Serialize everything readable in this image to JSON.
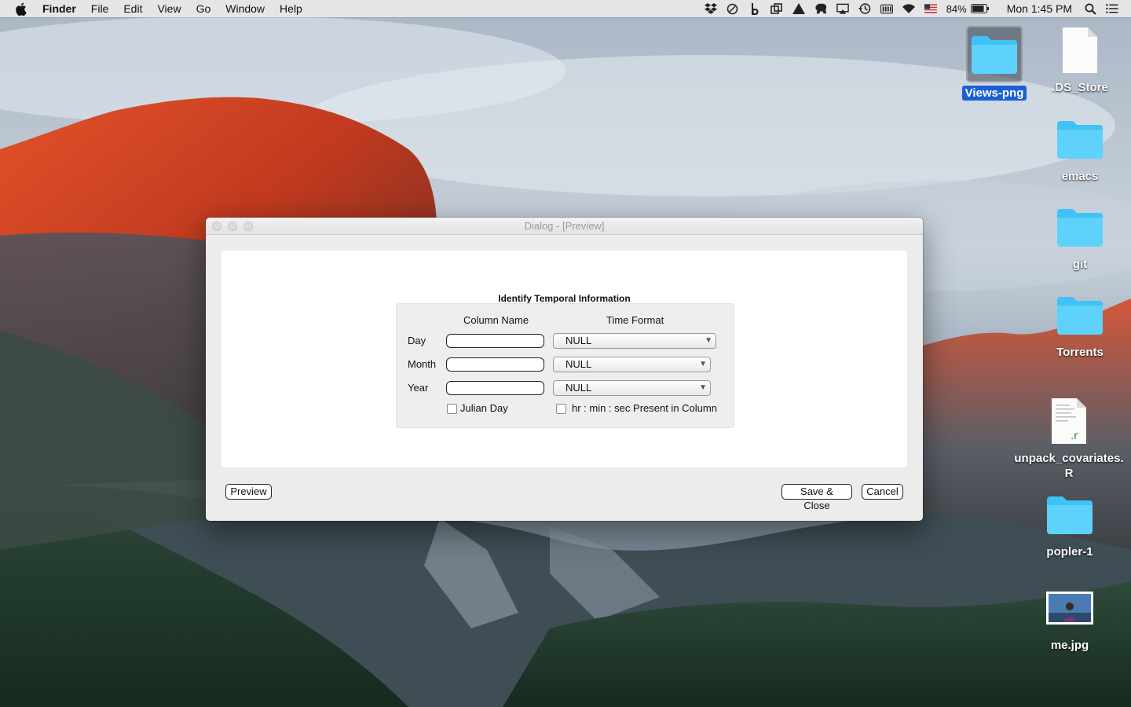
{
  "menubar": {
    "app": "Finder",
    "menus": [
      "File",
      "Edit",
      "View",
      "Go",
      "Window",
      "Help"
    ],
    "battery": "84%",
    "clock": "Mon 1:45 PM",
    "status_icons": [
      "dropbox-icon",
      "sync-icon",
      "b-icon",
      "screens-icon",
      "drive-icon",
      "evernote-icon",
      "airplay-icon",
      "time-machine-icon",
      "keyboard-icon",
      "wifi-icon",
      "us-flag-icon"
    ]
  },
  "desktop_icons": [
    {
      "label": "Views-png",
      "kind": "folder",
      "selected": true
    },
    {
      "label": ".DS_Store",
      "kind": "file"
    },
    {
      "label": "emacs",
      "kind": "folder"
    },
    {
      "label": "git",
      "kind": "folder"
    },
    {
      "label": "Torrents",
      "kind": "folder"
    },
    {
      "label": "unpack_covariates.R",
      "kind": "r-script"
    },
    {
      "label": "popler-1",
      "kind": "folder"
    },
    {
      "label": "me.jpg",
      "kind": "image"
    }
  ],
  "dialog": {
    "title": "Dialog - [Preview]",
    "section_title": "Identify Temporal Information",
    "column_headers": {
      "column_name": "Column Name",
      "time_format": "Time Format"
    },
    "rows": [
      {
        "label": "Day",
        "column_value": "",
        "format": "NULL"
      },
      {
        "label": "Month",
        "column_value": "",
        "format": "NULL"
      },
      {
        "label": "Year",
        "column_value": "",
        "format": "NULL"
      }
    ],
    "julian_day": {
      "label": "Julian Day",
      "checked": false
    },
    "hms_present": {
      "label": "hr : min : sec Present in Column",
      "checked": false
    },
    "buttons": {
      "preview": "Preview",
      "save_close": "Save & Close",
      "cancel": "Cancel"
    }
  },
  "colors": {
    "folder": "#3fc3f6",
    "selection": "#1a5fd6",
    "dialog_bg": "#ececec"
  }
}
